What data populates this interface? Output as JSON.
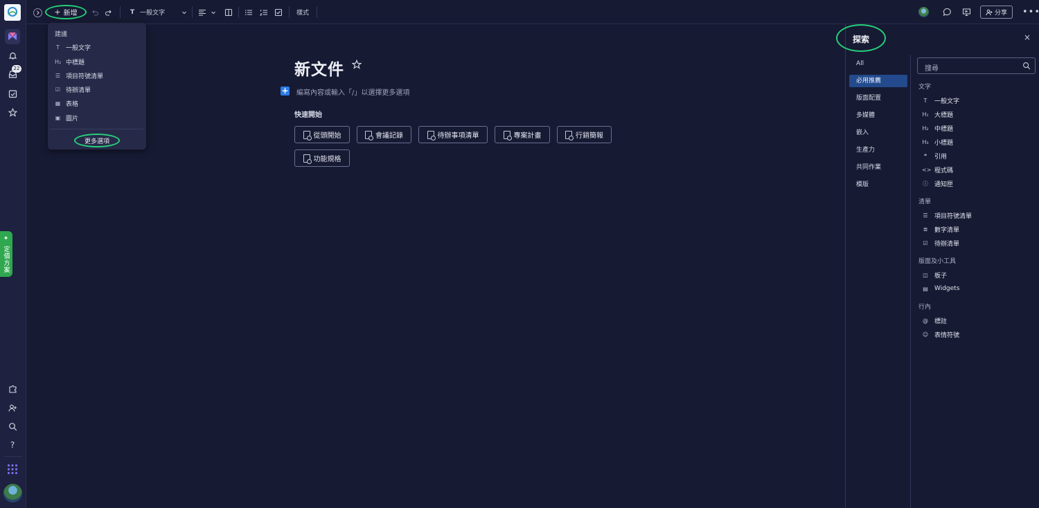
{
  "toolbar": {
    "add_label": "新增",
    "text_style_label": "一般文字",
    "styles_label": "樣式",
    "share_label": "分享"
  },
  "rail": {
    "inbox_badge": "22",
    "promo_label": "✦ 定價方案"
  },
  "dropdown": {
    "header": "建議",
    "items": [
      {
        "glyph": "T",
        "label": "一般文字"
      },
      {
        "glyph": "H₂",
        "label": "中標題"
      },
      {
        "glyph": "☰",
        "label": "項目符號清單"
      },
      {
        "glyph": "☑",
        "label": "待辦清單"
      },
      {
        "glyph": "▦",
        "label": "表格"
      },
      {
        "glyph": "▣",
        "label": "圖片"
      }
    ],
    "more_label": "更多選項"
  },
  "doc": {
    "title": "新文件",
    "placeholder": "編寫內容或輸入「/」以選擇更多選項",
    "quick_start_title": "快速開始",
    "quick_start": [
      "從頭開始",
      "會議記錄",
      "待辦事項清單",
      "專案計畫",
      "行銷簡報",
      "功能規格"
    ]
  },
  "panel": {
    "title": "探索",
    "close": "×",
    "categories": [
      "All",
      "必用推薦",
      "版面配置",
      "多媒體",
      "嵌入",
      "生產力",
      "共同作業",
      "模版"
    ],
    "active_category": "必用推薦",
    "search_placeholder": "搜尋",
    "sections": [
      {
        "title": "文字",
        "items": [
          {
            "glyph": "T",
            "label": "一般文字"
          },
          {
            "glyph": "H₁",
            "label": "大標題"
          },
          {
            "glyph": "H₂",
            "label": "中標題"
          },
          {
            "glyph": "H₃",
            "label": "小標題"
          },
          {
            "glyph": "❝",
            "label": "引用"
          },
          {
            "glyph": "<>",
            "label": "程式碼"
          },
          {
            "glyph": "ⓘ",
            "label": "通知匣"
          }
        ]
      },
      {
        "title": "清單",
        "items": [
          {
            "glyph": "☰",
            "label": "項目符號清單"
          },
          {
            "glyph": "≣",
            "label": "數字清單"
          },
          {
            "glyph": "☑",
            "label": "待辦清單"
          }
        ]
      },
      {
        "title": "版面及小工具",
        "items": [
          {
            "glyph": "◫",
            "label": "板子"
          },
          {
            "glyph": "▤",
            "label": "Widgets"
          }
        ]
      },
      {
        "title": "行內",
        "items": [
          {
            "glyph": "@",
            "label": "標註"
          },
          {
            "glyph": "☺",
            "label": "表情符號"
          }
        ]
      }
    ]
  },
  "colors": {
    "background": "#171a33",
    "accent_blue": "#2b7de9",
    "highlight_ring": "#25d07a",
    "active_category": "#234a8c",
    "promo": "#2fa84f"
  }
}
